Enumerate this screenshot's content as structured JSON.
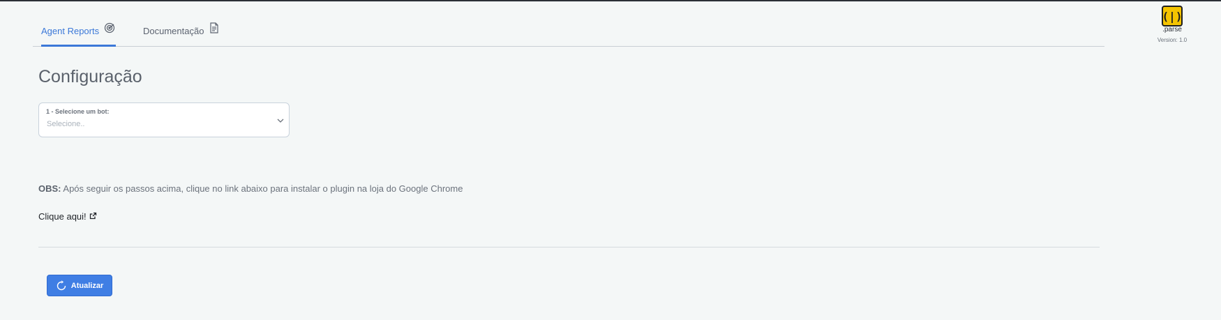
{
  "tabs": [
    {
      "label": "Agent Reports",
      "icon": "radar-icon",
      "active": true
    },
    {
      "label": "Documentação",
      "icon": "document-icon",
      "active": false
    }
  ],
  "brand": {
    "logo_text": "(|)",
    "name": ".parse",
    "version": "Version: 1.0",
    "logo_color": "#f5c400"
  },
  "page": {
    "title": "Configuração"
  },
  "bot_select": {
    "label": "1 - Selecione um bot:",
    "placeholder": "Selecione..",
    "icon": "chevron-down-icon"
  },
  "notice": {
    "prefix": "OBS:",
    "text": " Após seguir os passos acima, clique no link abaixo para instalar o plugin na loja do Google Chrome"
  },
  "install_link": {
    "label": "Clique aqui!",
    "icon": "external-link-icon"
  },
  "refresh_button": {
    "label": "Atualizar",
    "icon": "refresh-icon",
    "color": "#3f7ee4"
  },
  "colors": {
    "accent": "#3b78d8",
    "background": "#f4f7f7"
  }
}
